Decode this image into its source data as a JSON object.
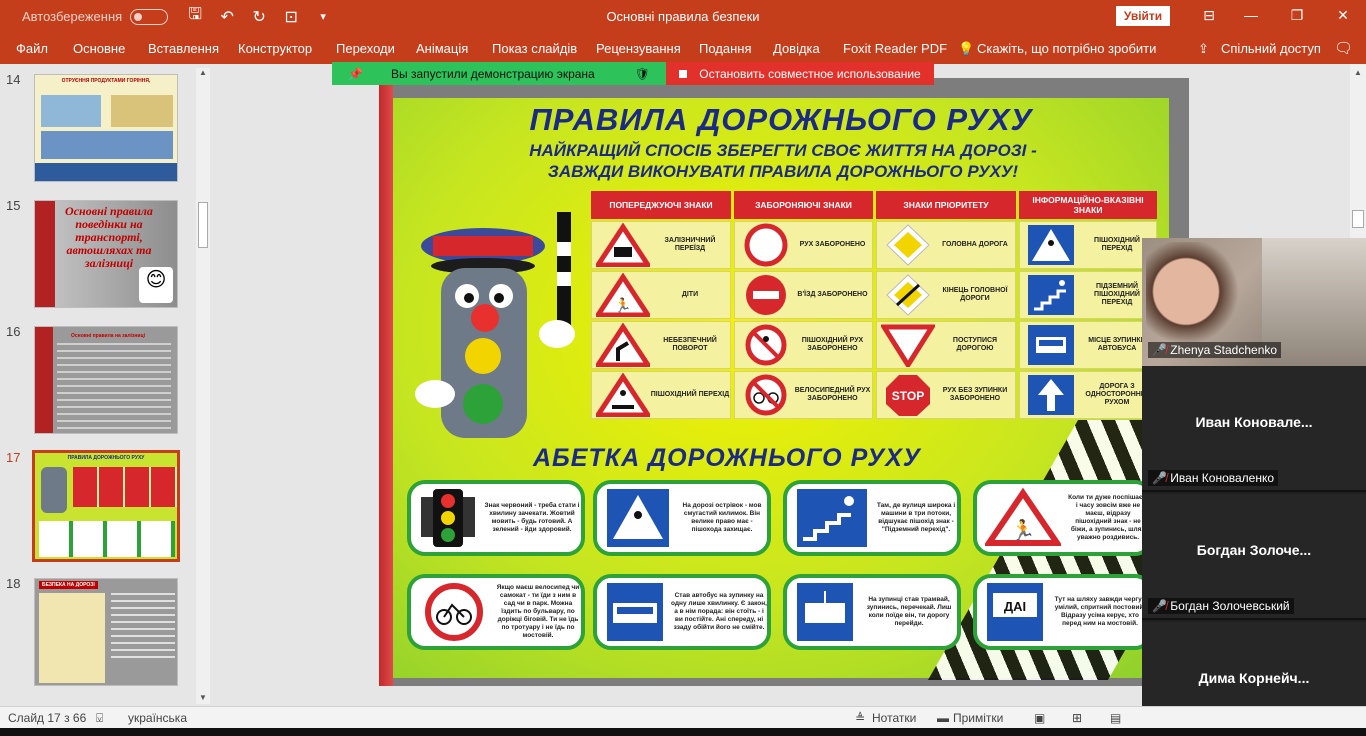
{
  "app": {
    "autosave_label": "Автозбереження",
    "doc_title": "Основні правила безпеки",
    "signin_label": "Увійти",
    "window_min": "—",
    "window_restore": "❐",
    "window_close": "✕"
  },
  "ribbon": {
    "tabs": [
      "Файл",
      "Основне",
      "Вставлення",
      "Конструктор",
      "Переходи",
      "Анімація",
      "Показ слайдів",
      "Рецензування",
      "Подання",
      "Довідка",
      "Foxit Reader PDF",
      "Скажіть, що потрібно зробити",
      "Спільний доступ"
    ]
  },
  "sharing": {
    "green_label": "Вы запустили демонстрацию экрана",
    "red_label": "Остановить совместное использование"
  },
  "thumbnails": [
    {
      "num": "14",
      "title": "ОТРУЄННЯ ПРОДУКТАМИ ГОРІННЯ,"
    },
    {
      "num": "15",
      "title": "Основні правила поведінки на транспорті, автошляхах та залізниці"
    },
    {
      "num": "16",
      "title": "Основні правила на залізниці"
    },
    {
      "num": "17",
      "title": "ПРАВИЛА ДОРОЖНЬОГО РУХУ"
    },
    {
      "num": "18",
      "title": "БЕЗПЕКА НА ДОРОЗІ"
    }
  ],
  "slide": {
    "title": "ПРАВИЛА ДОРОЖНЬОГО РУХУ",
    "subtitle_line1": "НАЙКРАЩИЙ СПОСІБ ЗБЕРЕГТИ СВОЄ ЖИТТЯ НА ДОРОЗІ -",
    "subtitle_line2": "ЗАВЖДИ ВИКОНУВАТИ ПРАВИЛА ДОРОЖНЬОГО РУХУ!",
    "columns": [
      "ПОПЕРЕДЖУЮЧІ ЗНАКИ",
      "ЗАБОРОНЯЮЧІ ЗНАКИ",
      "ЗНАКИ ПРІОРИТЕТУ",
      "ІНФОРМАЦІЙНО-ВКАЗІВНІ ЗНАКИ"
    ],
    "signs": [
      [
        "ЗАЛІЗНИЧНИЙ ПЕРЕЇЗД",
        "ДІТИ",
        "НЕБЕЗПЕЧНИЙ ПОВОРОТ",
        "ПІШОХІДНИЙ ПЕРЕХІД"
      ],
      [
        "РУХ ЗАБОРОНЕНО",
        "В'ЇЗД ЗАБОРОНЕНО",
        "ПІШОХІДНИЙ РУХ ЗАБОРОНЕНО",
        "ВЕЛОСИПЕДНИЙ РУХ ЗАБОРОНЕНО"
      ],
      [
        "ГОЛОВНА ДОРОГА",
        "КІНЕЦЬ ГОЛОВНОЇ ДОРОГИ",
        "ПОСТУПИСЯ ДОРОГОЮ",
        "РУХ БЕЗ ЗУПИНКИ ЗАБОРОНЕНО"
      ],
      [
        "ПІШОХІДНИЙ ПЕРЕХІД",
        "ПІДЗЕМНИЙ ПІШОХІДНИЙ ПЕРЕХІД",
        "МІСЦЕ ЗУПИНКИ АВТОБУСА",
        "ДОРОГА З ОДНОСТОРОННІМ РУХОМ"
      ]
    ],
    "stop_text": "STOP",
    "abetka_title": "АБЕТКА ДОРОЖНЬОГО РУХУ",
    "cards": [
      "Знак червоний - треба стати і хвилину зачекати. Жовтий мовить - будь готовий. А зелений - йди здоровий.",
      "На дорозі острівок - мов смугастий килимок. Він велике право має - пішохода захищає.",
      "Там, де вулиця широка і машини в три потоки, відшукає пішохід знак - \"Підземний перехід\".",
      "Коли ти дуже поспішаєш і часу зовсім вже не маєш, відразу пішохідний знак - не біжи, а зупинись, шлях уважно роздивись.",
      "Якщо маєш велосипед чи самокат - ти їди з ним в сад чи в парк. Можна їздить по бульвару, по доріжці біговій. Ти не їдь по тротуару і не їдь по мостовій.",
      "Став автобус на зупинку на одну лише хвилинку. Є закон, а в нім порада: він стоїть - і ви постійте. Ані спереду, ні ззаду обійти його не смійте.",
      "На зупинці став трамвай, зупинись, перечекай. Лиш коли поїде він, ти дорогу перейди.",
      "Тут на шляху завжди чергує умілий, спритний постовий. Відразу усіма керує, хто перед ним на мостовій."
    ],
    "dai_text": "ДАІ"
  },
  "participants": [
    {
      "big": "",
      "caption": "Zhenya Stadchenko",
      "camera": true
    },
    {
      "big": "Иван  Коновале...",
      "caption": "Иван Коноваленко",
      "camera": false
    },
    {
      "big": "Богдан  Золоче...",
      "caption": "Богдан Золочевський",
      "camera": false
    },
    {
      "big": "Дима  Корнейч...",
      "caption": "",
      "camera": false
    }
  ],
  "status": {
    "slide_info": "Слайд 17 з 66",
    "language": "українська",
    "notes": "Нотатки",
    "comments": "Примітки"
  },
  "colors": {
    "brand": "#c43e1c",
    "share_green": "#2ec25a",
    "share_red": "#e2312a",
    "poster_title": "#1b2a86",
    "sign_header": "#d6272c"
  }
}
